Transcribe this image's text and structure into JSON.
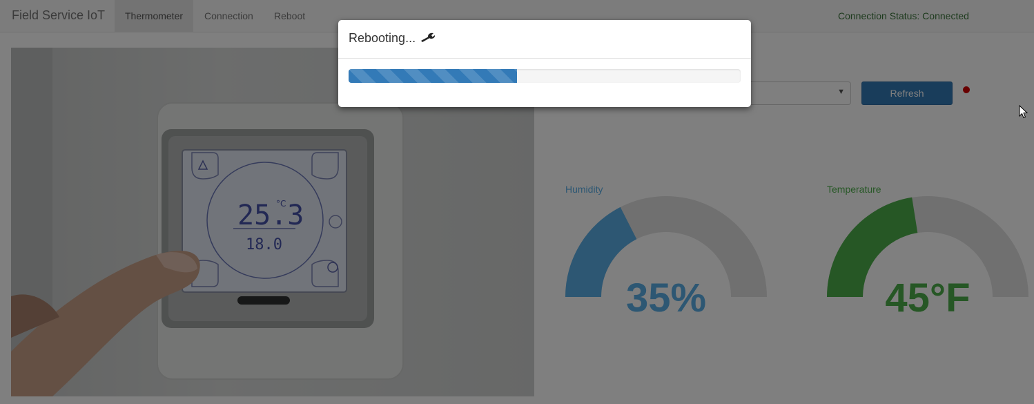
{
  "navbar": {
    "brand": "Field Service IoT",
    "items": [
      {
        "label": "Thermometer",
        "active": true
      },
      {
        "label": "Connection",
        "active": false
      },
      {
        "label": "Reboot",
        "active": false
      }
    ],
    "status": "Connection Status: Connected"
  },
  "photo": {
    "display_main": "25.3",
    "display_sub": "18.0",
    "unit": "°C"
  },
  "controls": {
    "refresh_label": "Refresh",
    "select_value": ""
  },
  "gauges": {
    "humidity": {
      "label": "Humidity",
      "value_text": "35%",
      "percent": 35,
      "color": "#5aaee6"
    },
    "temperature": {
      "label": "Temperature",
      "value_text": "45°F",
      "percent": 45,
      "color": "#4daf4a"
    }
  },
  "modal": {
    "title": "Rebooting...",
    "progress_percent": 43
  }
}
